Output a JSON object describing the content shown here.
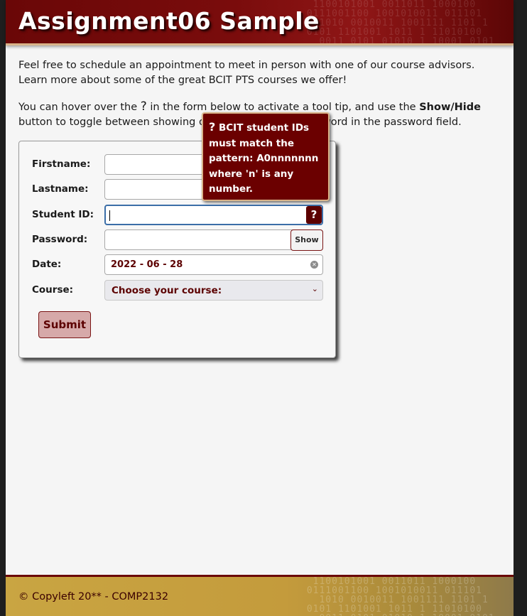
{
  "header": {
    "title": "Assignment06 Sample"
  },
  "intro": {
    "paragraph1": "Feel free to schedule an appointment to meet in person with one of our course advisors. Learn more about some of the great BCIT PTS courses we offer!",
    "paragraph2_part1": "You can hover over the ",
    "help_glyph": "?",
    "paragraph2_part2": " in the form below to activate a tool tip, and use the ",
    "show_hide": "Show/Hide",
    "paragraph2_part3": " button to toggle between showing or not showing the password in the password field."
  },
  "form": {
    "firstname_label": "Firstname:",
    "firstname_value": "",
    "lastname_label": "Lastname:",
    "lastname_value": "",
    "studentid_label": "Student ID:",
    "studentid_value": "",
    "studentid_help": "?",
    "password_label": "Password:",
    "password_value": "",
    "show_button": "Show",
    "date_label": "Date:",
    "date_value": "2022 - 06 - 28",
    "course_label": "Course:",
    "course_selected": "Choose your course:",
    "submit_label": "Submit"
  },
  "tooltip": {
    "glyph": "?",
    "text": "BCIT student IDs must match the pattern: A0nnnnnnn where 'n' is any number."
  },
  "footer": {
    "text": "© Copyleft 20** - COMP2132"
  },
  "colors": {
    "brand_maroon": "#6b0000",
    "accent_gold": "#d9b48a",
    "footer_gold": "#c9a542"
  },
  "icons": [
    "help-icon",
    "clear-icon",
    "chevron-down-icon"
  ]
}
